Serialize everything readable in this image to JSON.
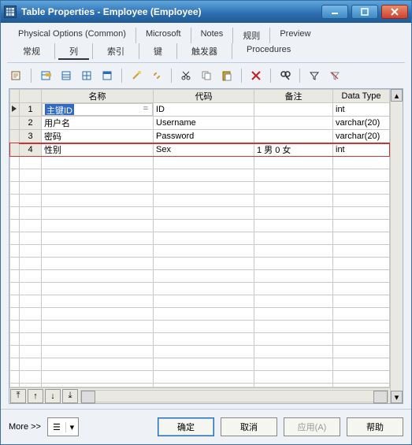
{
  "window": {
    "title": "Table Properties - Employee (Employee)"
  },
  "tabs": {
    "row1": [
      "Physical Options (Common)",
      "Microsoft",
      "Notes",
      "规则",
      "Preview"
    ],
    "row2": [
      "常规",
      "列",
      "索引",
      "键",
      "触发器",
      "Procedures"
    ],
    "active": "列"
  },
  "grid": {
    "headers": [
      "名称",
      "代码",
      "备注",
      "Data Type"
    ],
    "rows": [
      {
        "num": "1",
        "name": "主键ID",
        "code": "ID",
        "remark": "",
        "datatype": "int",
        "indicator": true,
        "selected": true
      },
      {
        "num": "2",
        "name": "用户名",
        "code": "Username",
        "remark": "",
        "datatype": "varchar(20)"
      },
      {
        "num": "3",
        "name": "密码",
        "code": "Password",
        "remark": "",
        "datatype": "varchar(20)"
      },
      {
        "num": "4",
        "name": "性别",
        "code": "Sex",
        "remark": "1 男 0 女",
        "datatype": "int",
        "highlighted": true
      }
    ]
  },
  "footer": {
    "more": "More >>",
    "ok": "确定",
    "cancel": "取消",
    "apply": "应用(A)",
    "help": "帮助"
  }
}
